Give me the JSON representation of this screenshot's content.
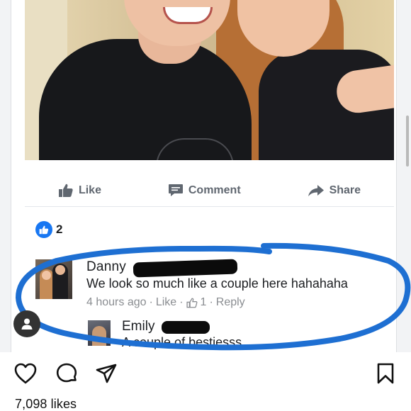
{
  "post_image": {
    "actions": {
      "like_label": "Like",
      "comment_label": "Comment",
      "share_label": "Share"
    },
    "reactions": {
      "count": "2"
    },
    "comment": {
      "author": "Danny",
      "text": "We look so much like a couple here hahahaha",
      "time": "4 hours ago",
      "like_link": "Like",
      "like_count": "1",
      "reply_link": "Reply",
      "separator": "·"
    },
    "reply": {
      "author": "Emily",
      "text": "A couple of bestiesss"
    }
  },
  "instagram": {
    "likes": "7,098 likes"
  },
  "colors": {
    "facebook_blue": "#1877f2",
    "circle_blue": "#1e6fd2",
    "meta_gray": "#8a8d91"
  },
  "icons": [
    "thumbs-up-icon",
    "comment-icon",
    "share-arrow-icon",
    "heart-icon",
    "speech-bubble-icon",
    "send-icon",
    "bookmark-icon",
    "person-tag-icon"
  ]
}
